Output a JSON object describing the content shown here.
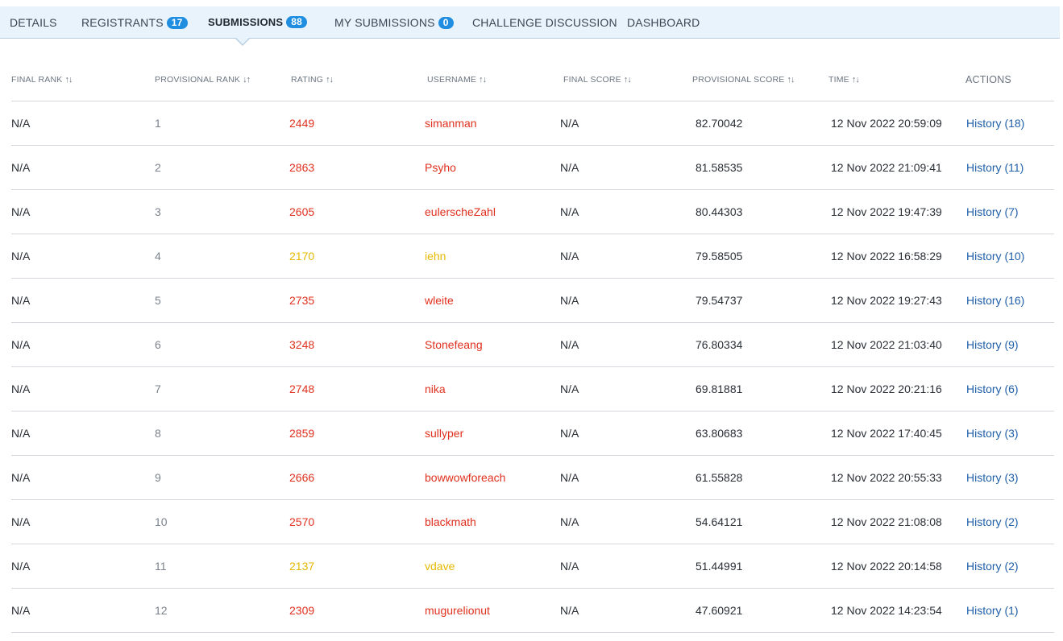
{
  "tabs": [
    {
      "label": "DETAILS",
      "badge": null
    },
    {
      "label": "REGISTRANTS",
      "badge": "17"
    },
    {
      "label": "SUBMISSIONS",
      "badge": "88",
      "active": true
    },
    {
      "label": "MY SUBMISSIONS",
      "badge": "0"
    },
    {
      "label": "CHALLENGE DISCUSSION",
      "badge": null
    },
    {
      "label": "DASHBOARD",
      "badge": null
    }
  ],
  "columns": {
    "final_rank": "FINAL RANK",
    "provisional_rank": "PROVISIONAL RANK",
    "rating": "RATING",
    "username": "USERNAME",
    "final_score": "FINAL SCORE",
    "provisional_score": "PROVISIONAL SCORE",
    "time": "TIME",
    "actions": "ACTIONS"
  },
  "sort_icons": {
    "default": "↑↓",
    "provisional_rank": "↓↑"
  },
  "colors": {
    "rating_red": "#e0301e",
    "rating_yellow": "#e6b800",
    "link": "#1f5fa8",
    "badge": "#1f8ee0",
    "tabbar_bg": "#e9f3fb"
  },
  "rows": [
    {
      "final_rank": "N/A",
      "provisional_rank": "1",
      "rating": "2449",
      "username": "simanman",
      "color": "red",
      "final_score": "N/A",
      "provisional_score": "82.70042",
      "time": "12 Nov 2022 20:59:09",
      "action": "History (18)"
    },
    {
      "final_rank": "N/A",
      "provisional_rank": "2",
      "rating": "2863",
      "username": "Psyho",
      "color": "red",
      "final_score": "N/A",
      "provisional_score": "81.58535",
      "time": "12 Nov 2022 21:09:41",
      "action": "History (11)"
    },
    {
      "final_rank": "N/A",
      "provisional_rank": "3",
      "rating": "2605",
      "username": "eulerscheZahl",
      "color": "red",
      "final_score": "N/A",
      "provisional_score": "80.44303",
      "time": "12 Nov 2022 19:47:39",
      "action": "History (7)"
    },
    {
      "final_rank": "N/A",
      "provisional_rank": "4",
      "rating": "2170",
      "username": "iehn",
      "color": "yellow",
      "final_score": "N/A",
      "provisional_score": "79.58505",
      "time": "12 Nov 2022 16:58:29",
      "action": "History (10)"
    },
    {
      "final_rank": "N/A",
      "provisional_rank": "5",
      "rating": "2735",
      "username": "wleite",
      "color": "red",
      "final_score": "N/A",
      "provisional_score": "79.54737",
      "time": "12 Nov 2022 19:27:43",
      "action": "History (16)"
    },
    {
      "final_rank": "N/A",
      "provisional_rank": "6",
      "rating": "3248",
      "username": "Stonefeang",
      "color": "red",
      "final_score": "N/A",
      "provisional_score": "76.80334",
      "time": "12 Nov 2022 21:03:40",
      "action": "History (9)"
    },
    {
      "final_rank": "N/A",
      "provisional_rank": "7",
      "rating": "2748",
      "username": "nika",
      "color": "red",
      "final_score": "N/A",
      "provisional_score": "69.81881",
      "time": "12 Nov 2022 20:21:16",
      "action": "History (6)"
    },
    {
      "final_rank": "N/A",
      "provisional_rank": "8",
      "rating": "2859",
      "username": "sullyper",
      "color": "red",
      "final_score": "N/A",
      "provisional_score": "63.80683",
      "time": "12 Nov 2022 17:40:45",
      "action": "History (3)"
    },
    {
      "final_rank": "N/A",
      "provisional_rank": "9",
      "rating": "2666",
      "username": "bowwowforeach",
      "color": "red",
      "final_score": "N/A",
      "provisional_score": "61.55828",
      "time": "12 Nov 2022 20:55:33",
      "action": "History (3)"
    },
    {
      "final_rank": "N/A",
      "provisional_rank": "10",
      "rating": "2570",
      "username": "blackmath",
      "color": "red",
      "final_score": "N/A",
      "provisional_score": "54.64121",
      "time": "12 Nov 2022 21:08:08",
      "action": "History (2)"
    },
    {
      "final_rank": "N/A",
      "provisional_rank": "11",
      "rating": "2137",
      "username": "vdave",
      "color": "yellow",
      "final_score": "N/A",
      "provisional_score": "51.44991",
      "time": "12 Nov 2022 20:14:58",
      "action": "History (2)"
    },
    {
      "final_rank": "N/A",
      "provisional_rank": "12",
      "rating": "2309",
      "username": "mugurelionut",
      "color": "red",
      "final_score": "N/A",
      "provisional_score": "47.60921",
      "time": "12 Nov 2022 14:23:54",
      "action": "History (1)"
    }
  ]
}
